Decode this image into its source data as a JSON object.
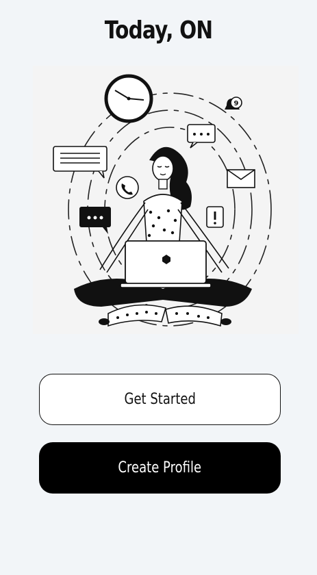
{
  "header": {
    "title": "Today, ON"
  },
  "illustration": {
    "subject": "meditating-woman-illustration",
    "notification_count": "9"
  },
  "actions": {
    "get_started_label": "Get Started",
    "create_profile_label": "Create Profile"
  },
  "colors": {
    "background": "#f2f5f8",
    "primary": "#000000",
    "on_primary": "#ffffff",
    "outline": "#111111"
  }
}
